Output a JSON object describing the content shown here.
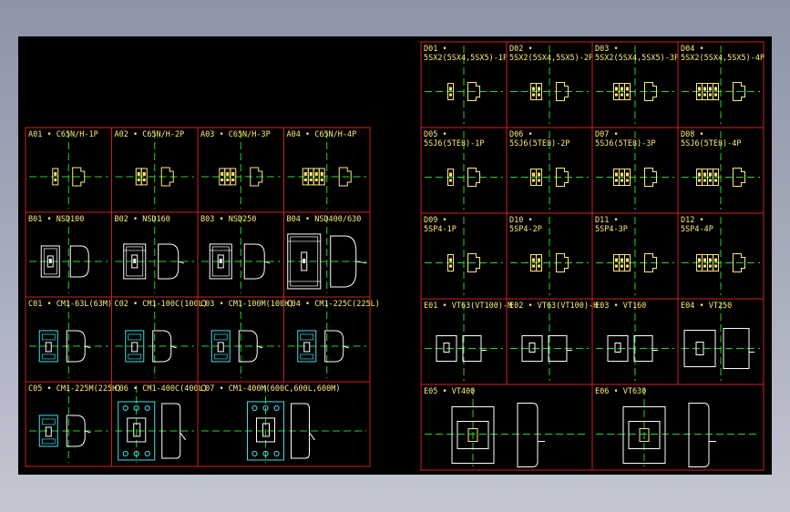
{
  "colors": {
    "background": "#000000",
    "frame": "#d21f1f",
    "centerline": "#27d427",
    "yellow": "#ffe97a",
    "cyan": "#40e0e8",
    "white": "#ffffff"
  },
  "left_table": {
    "rows": [
      [
        {
          "label": "A01 • C65N/H-1P",
          "symbol": "miniature",
          "poles": 1
        },
        {
          "label": "A02 • C65N/H-2P",
          "symbol": "miniature",
          "poles": 2
        },
        {
          "label": "A03 • C65N/H-3P",
          "symbol": "miniature",
          "poles": 3
        },
        {
          "label": "A04 • C65N/H-4P",
          "symbol": "miniature",
          "poles": 4
        }
      ],
      [
        {
          "label": "B01 • NSD100",
          "symbol": "mccb-small"
        },
        {
          "label": "B02 • NSD160",
          "symbol": "mccb-3p"
        },
        {
          "label": "B03 • NSD250",
          "symbol": "mccb-3p"
        },
        {
          "label": "B04 • NSD400/630",
          "symbol": "mccb-large"
        }
      ],
      [
        {
          "label": "C01 • CM1-63L(63M)",
          "symbol": "cm1-cyan"
        },
        {
          "label": "C02 • CM1-100C(100L)",
          "symbol": "cm1-cyan"
        },
        {
          "label": "C03 • CM1-100M(100H)",
          "symbol": "cm1-cyan"
        },
        {
          "label": "C04 • CM1-225C(225L)",
          "symbol": "cm1-cyan"
        }
      ],
      [
        {
          "label": "C05 • CM1-225M(225H)",
          "symbol": "cm1-cyan"
        },
        {
          "label": "C06 • CM1-400C(400L)",
          "symbol": "cm1-big"
        },
        {
          "label": "C07 • CM1-400M(600C,600L,600M)",
          "symbol": "cm1-big"
        }
      ]
    ]
  },
  "right_table": {
    "rows": [
      [
        {
          "label": "D01 •",
          "label2": "5SX2(5SX4,5SX5)-1P",
          "symbol": "miniature",
          "poles": 1
        },
        {
          "label": "D02 •",
          "label2": "5SX2(5SX4,5SX5)-2P",
          "symbol": "miniature",
          "poles": 2
        },
        {
          "label": "D03 •",
          "label2": "5SX2(5SX4,5SX5)-3P",
          "symbol": "miniature",
          "poles": 3
        },
        {
          "label": "D04 •",
          "label2": "5SX2(5SX4,5SX5)-4P",
          "symbol": "miniature",
          "poles": 4
        }
      ],
      [
        {
          "label": "D05 •",
          "label2": "5SJ6(5TE8)-1P",
          "symbol": "miniature",
          "poles": 1
        },
        {
          "label": "D06 •",
          "label2": "5SJ6(5TE8)-2P",
          "symbol": "miniature",
          "poles": 2
        },
        {
          "label": "D07 •",
          "label2": "5SJ6(5TE8)-3P",
          "symbol": "miniature",
          "poles": 3
        },
        {
          "label": "D08 •",
          "label2": "5SJ6(5TE8)-4P",
          "symbol": "miniature",
          "poles": 4
        }
      ],
      [
        {
          "label": "D09 •",
          "label2": "5SP4-1P",
          "symbol": "miniature",
          "poles": 1
        },
        {
          "label": "D10 •",
          "label2": "5SP4-2P",
          "symbol": "miniature",
          "poles": 2
        },
        {
          "label": "D11 •",
          "label2": "5SP4-3P",
          "symbol": "miniature",
          "poles": 3
        },
        {
          "label": "D12 •",
          "label2": "5SP4-4P",
          "symbol": "miniature",
          "poles": 4
        }
      ],
      [
        {
          "label": "E01 • VT63(VT100)-M",
          "symbol": "vt"
        },
        {
          "label": "E02 • VT63(VT100)-H",
          "symbol": "vt"
        },
        {
          "label": "E03 • VT160",
          "symbol": "vt"
        },
        {
          "label": "E04 • VT250",
          "symbol": "vt-wide"
        }
      ],
      [
        {
          "label": "E05 • VT400",
          "symbol": "vt-big"
        },
        {
          "label": "E06 • VT630",
          "symbol": "vt-big"
        }
      ]
    ]
  }
}
